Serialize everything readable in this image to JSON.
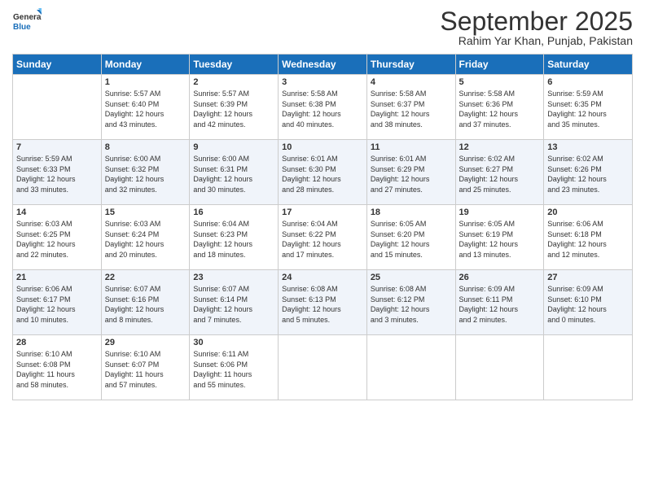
{
  "logo": {
    "general": "General",
    "blue": "Blue"
  },
  "header": {
    "month_title": "September 2025",
    "location": "Rahim Yar Khan, Punjab, Pakistan"
  },
  "days_of_week": [
    "Sunday",
    "Monday",
    "Tuesday",
    "Wednesday",
    "Thursday",
    "Friday",
    "Saturday"
  ],
  "weeks": [
    [
      {
        "day": "",
        "info": ""
      },
      {
        "day": "1",
        "info": "Sunrise: 5:57 AM\nSunset: 6:40 PM\nDaylight: 12 hours\nand 43 minutes."
      },
      {
        "day": "2",
        "info": "Sunrise: 5:57 AM\nSunset: 6:39 PM\nDaylight: 12 hours\nand 42 minutes."
      },
      {
        "day": "3",
        "info": "Sunrise: 5:58 AM\nSunset: 6:38 PM\nDaylight: 12 hours\nand 40 minutes."
      },
      {
        "day": "4",
        "info": "Sunrise: 5:58 AM\nSunset: 6:37 PM\nDaylight: 12 hours\nand 38 minutes."
      },
      {
        "day": "5",
        "info": "Sunrise: 5:58 AM\nSunset: 6:36 PM\nDaylight: 12 hours\nand 37 minutes."
      },
      {
        "day": "6",
        "info": "Sunrise: 5:59 AM\nSunset: 6:35 PM\nDaylight: 12 hours\nand 35 minutes."
      }
    ],
    [
      {
        "day": "7",
        "info": "Sunrise: 5:59 AM\nSunset: 6:33 PM\nDaylight: 12 hours\nand 33 minutes."
      },
      {
        "day": "8",
        "info": "Sunrise: 6:00 AM\nSunset: 6:32 PM\nDaylight: 12 hours\nand 32 minutes."
      },
      {
        "day": "9",
        "info": "Sunrise: 6:00 AM\nSunset: 6:31 PM\nDaylight: 12 hours\nand 30 minutes."
      },
      {
        "day": "10",
        "info": "Sunrise: 6:01 AM\nSunset: 6:30 PM\nDaylight: 12 hours\nand 28 minutes."
      },
      {
        "day": "11",
        "info": "Sunrise: 6:01 AM\nSunset: 6:29 PM\nDaylight: 12 hours\nand 27 minutes."
      },
      {
        "day": "12",
        "info": "Sunrise: 6:02 AM\nSunset: 6:27 PM\nDaylight: 12 hours\nand 25 minutes."
      },
      {
        "day": "13",
        "info": "Sunrise: 6:02 AM\nSunset: 6:26 PM\nDaylight: 12 hours\nand 23 minutes."
      }
    ],
    [
      {
        "day": "14",
        "info": "Sunrise: 6:03 AM\nSunset: 6:25 PM\nDaylight: 12 hours\nand 22 minutes."
      },
      {
        "day": "15",
        "info": "Sunrise: 6:03 AM\nSunset: 6:24 PM\nDaylight: 12 hours\nand 20 minutes."
      },
      {
        "day": "16",
        "info": "Sunrise: 6:04 AM\nSunset: 6:23 PM\nDaylight: 12 hours\nand 18 minutes."
      },
      {
        "day": "17",
        "info": "Sunrise: 6:04 AM\nSunset: 6:22 PM\nDaylight: 12 hours\nand 17 minutes."
      },
      {
        "day": "18",
        "info": "Sunrise: 6:05 AM\nSunset: 6:20 PM\nDaylight: 12 hours\nand 15 minutes."
      },
      {
        "day": "19",
        "info": "Sunrise: 6:05 AM\nSunset: 6:19 PM\nDaylight: 12 hours\nand 13 minutes."
      },
      {
        "day": "20",
        "info": "Sunrise: 6:06 AM\nSunset: 6:18 PM\nDaylight: 12 hours\nand 12 minutes."
      }
    ],
    [
      {
        "day": "21",
        "info": "Sunrise: 6:06 AM\nSunset: 6:17 PM\nDaylight: 12 hours\nand 10 minutes."
      },
      {
        "day": "22",
        "info": "Sunrise: 6:07 AM\nSunset: 6:16 PM\nDaylight: 12 hours\nand 8 minutes."
      },
      {
        "day": "23",
        "info": "Sunrise: 6:07 AM\nSunset: 6:14 PM\nDaylight: 12 hours\nand 7 minutes."
      },
      {
        "day": "24",
        "info": "Sunrise: 6:08 AM\nSunset: 6:13 PM\nDaylight: 12 hours\nand 5 minutes."
      },
      {
        "day": "25",
        "info": "Sunrise: 6:08 AM\nSunset: 6:12 PM\nDaylight: 12 hours\nand 3 minutes."
      },
      {
        "day": "26",
        "info": "Sunrise: 6:09 AM\nSunset: 6:11 PM\nDaylight: 12 hours\nand 2 minutes."
      },
      {
        "day": "27",
        "info": "Sunrise: 6:09 AM\nSunset: 6:10 PM\nDaylight: 12 hours\nand 0 minutes."
      }
    ],
    [
      {
        "day": "28",
        "info": "Sunrise: 6:10 AM\nSunset: 6:08 PM\nDaylight: 11 hours\nand 58 minutes."
      },
      {
        "day": "29",
        "info": "Sunrise: 6:10 AM\nSunset: 6:07 PM\nDaylight: 11 hours\nand 57 minutes."
      },
      {
        "day": "30",
        "info": "Sunrise: 6:11 AM\nSunset: 6:06 PM\nDaylight: 11 hours\nand 55 minutes."
      },
      {
        "day": "",
        "info": ""
      },
      {
        "day": "",
        "info": ""
      },
      {
        "day": "",
        "info": ""
      },
      {
        "day": "",
        "info": ""
      }
    ]
  ]
}
